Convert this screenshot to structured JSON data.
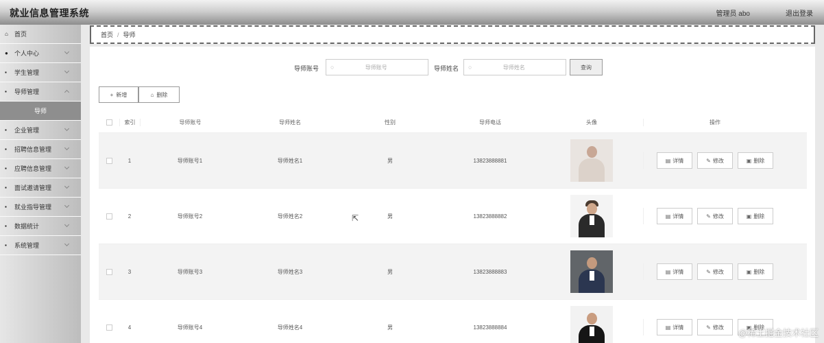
{
  "header": {
    "app_title": "就业信息管理系统",
    "user_info": "管理员 abo",
    "logout_label": "退出登录"
  },
  "sidebar": {
    "items": [
      {
        "icon": "home-icon",
        "glyph": "⌂",
        "label": "首页",
        "expandable": false
      },
      {
        "icon": "user-icon",
        "glyph": "●",
        "label": "个人中心",
        "expandable": true
      },
      {
        "icon": "grid-icon",
        "glyph": "▪",
        "label": "学生管理",
        "expandable": true
      },
      {
        "icon": "grid-icon",
        "glyph": "▪",
        "label": "导师管理",
        "expandable": true
      },
      {
        "icon": "",
        "glyph": "",
        "label": "导师",
        "expandable": false,
        "sub": true
      },
      {
        "icon": "building-icon",
        "glyph": "▪",
        "label": "企业管理",
        "expandable": true
      },
      {
        "icon": "doc-icon",
        "glyph": "▪",
        "label": "招聘信息管理",
        "expandable": true
      },
      {
        "icon": "grid-icon",
        "glyph": "▪",
        "label": "应聘信息管理",
        "expandable": true
      },
      {
        "icon": "chat-icon",
        "glyph": "▪",
        "label": "面试邀请管理",
        "expandable": true
      },
      {
        "icon": "chat-icon",
        "glyph": "▪",
        "label": "就业指导管理",
        "expandable": true
      },
      {
        "icon": "grid-icon",
        "glyph": "▪",
        "label": "数据统计",
        "expandable": true
      },
      {
        "icon": "grid-icon",
        "glyph": "▪",
        "label": "系统管理",
        "expandable": true
      }
    ]
  },
  "breadcrumb": {
    "home": "首页",
    "separator": "/",
    "current": "导师"
  },
  "search": {
    "account_label": "导师账号",
    "account_placeholder": "导师账号",
    "name_label": "导师姓名",
    "name_placeholder": "导师姓名",
    "query_label": "查询"
  },
  "actions": {
    "add_label": "新增",
    "delete_label": "删除"
  },
  "table": {
    "columns": [
      "索引",
      "导师账号",
      "导师姓名",
      "性别",
      "导师电话",
      "头像",
      "操作"
    ],
    "rows": [
      {
        "index": "1",
        "account": "导师账号1",
        "name": "导师姓名1",
        "sex": "男",
        "phone": "13823888881"
      },
      {
        "index": "2",
        "account": "导师账号2",
        "name": "导师姓名2",
        "sex": "男",
        "phone": "13823888882"
      },
      {
        "index": "3",
        "account": "导师账号3",
        "name": "导师姓名3",
        "sex": "男",
        "phone": "13823888883"
      },
      {
        "index": "4",
        "account": "导师账号4",
        "name": "导师姓名4",
        "sex": "男",
        "phone": "13823888884"
      }
    ],
    "row_actions": {
      "detail": "详情",
      "edit": "修改",
      "delete": "删除"
    }
  },
  "watermark": "@稀土掘金技术社区"
}
